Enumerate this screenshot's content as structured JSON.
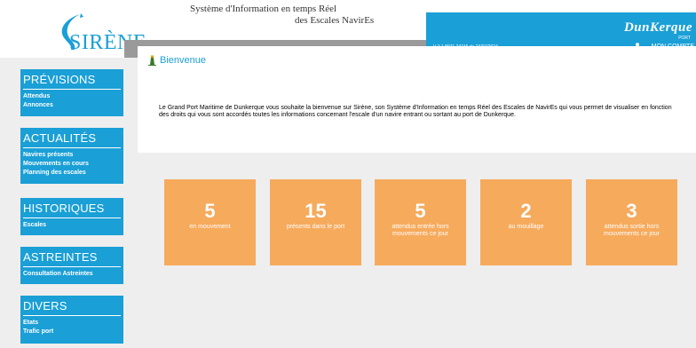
{
  "header": {
    "logo_text": "SIRÈNE",
    "system_title_line1": "Système d'Information en temps Réel",
    "system_title_line2": "des Escales NavirEs",
    "brand": "DunKerque",
    "brand_sub": "PORT",
    "version": "V 2.1.8971.24745 du 24/07/2024",
    "account_label": "MON COMPTE",
    "accent_color": "#1a9fd6"
  },
  "sidebar": [
    {
      "title": "PRÉVISIONS",
      "items": [
        "Attendus",
        "Annonces"
      ]
    },
    {
      "title": "ACTUALITÉS",
      "items": [
        "Navires présents",
        "Mouvements en cours",
        "Planning des escales"
      ]
    },
    {
      "title": "HISTORIQUES",
      "items": [
        "Escales"
      ]
    },
    {
      "title": "ASTREINTES",
      "items": [
        "Consultation Astreintes"
      ]
    },
    {
      "title": "DIVERS",
      "items": [
        "Etats",
        "Trafic port"
      ]
    }
  ],
  "welcome": {
    "title": "Bienvenue",
    "text": "Le Grand Port Maritime de Dunkerque vous souhaite la bienvenue sur Sirène,  son Système d'Information en temps Réel des Escales de NavirEs  qui vous permet de visualiser en fonction des droits qui vous sont accordés  toutes les informations concernant l'escale d'un navire entrant ou sortant au port de Dunkerque."
  },
  "tiles": [
    {
      "value": "5",
      "label": "en mouvement"
    },
    {
      "value": "15",
      "label": "présents dans le port"
    },
    {
      "value": "5",
      "label": "attendus entrée hors mouvements ce jour"
    },
    {
      "value": "2",
      "label": "au mouillage"
    },
    {
      "value": "3",
      "label": "attendus sortie hors mouvements ce jour"
    }
  ],
  "tile_color": "#f6aa5c"
}
